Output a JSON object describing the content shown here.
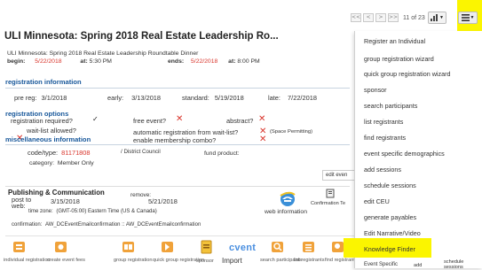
{
  "pager": {
    "first": "<<",
    "prev": "<",
    "next": ">",
    "last": ">>",
    "count": "11 of 23"
  },
  "event": {
    "title": "ULI Minnesota: Spring 2018 Real Estate Leadership Ro...",
    "subtitle": "ULI Minnesota: Spring 2018 Real Estate Leadership Roundtable Dinner",
    "begin_label": "begin:",
    "begin_date": "5/22/2018",
    "at_label": "at:",
    "begin_time": "5:30 PM",
    "ends_label": "ends:",
    "end_date": "5/22/2018",
    "end_at_label": "at:",
    "end_time": "8:00 PM"
  },
  "registration_info": {
    "heading": "registration information",
    "prereg_label": "pre reg:",
    "prereg_date": "3/1/2018",
    "early_label": "early:",
    "early_date": "3/13/2018",
    "standard_label": "standard:",
    "standard_date": "5/19/2018",
    "late_label": "late:",
    "late_date": "7/22/2018"
  },
  "registration_options": {
    "heading": "registration options",
    "required_label": "registration required?",
    "required_mark": "✓",
    "free_label": "free event?",
    "free_mark": "✕",
    "abstract_label": "abstract?",
    "abstract_mark": "✕",
    "waitlist_label": "wait-list allowed?",
    "waitlist_mark": "✕",
    "auto_label": "automatic registration from wait-list?",
    "auto_mark": "✕",
    "auto_note": "(Space Permitting)",
    "combo_label": "enable membership combo?"
  },
  "misc": {
    "heading": "miscellaneous information",
    "code_label": "code/type:",
    "code_value": "81171808",
    "code_type": "/ District Council",
    "fund_label": "fund product:",
    "category_label": "category:",
    "category_value": "Member Only",
    "edit_label": "edit even"
  },
  "publishing": {
    "heading": "Publishing & Communication",
    "post_label": "post to web:",
    "post_date": "3/15/2018",
    "remove_label": "remove:",
    "remove_date": "5/21/2018",
    "web_info": "web information",
    "confirmation_te": "Confirmation Te",
    "timezone_label": "time zone:",
    "timezone_value": "(GMT-05:00) Eastern Time (US & Canada)",
    "confirmation_label": "confirmation:",
    "confirmation_value": "AW_DCEventEmailconfirmation :: AW_DCEventEmailconfirmation"
  },
  "menu": {
    "items": [
      "Register an Individual",
      "group registration wizard",
      "quick group registration wizard",
      "sponsor",
      "search participants",
      "list registrants",
      "find registrants",
      "event specific demographics",
      "add sessions",
      "schedule sessions",
      "edit CEU",
      "generate payables",
      "Edit Narrative/Video",
      "Knowledge Finder",
      "Event Specific"
    ],
    "bottom_add": "add",
    "bottom_schedule": "schedule sessions"
  },
  "icon_bar": {
    "individual": "individual registration",
    "create": "create event fees",
    "group": "group registration",
    "quick": "quick group registration",
    "sponsor": "sponsor",
    "import": "Import",
    "cvent": "cvent",
    "search": "search participants",
    "list": "list registrants",
    "find": "find registrants"
  },
  "highlight_color": "#fbf500",
  "accent_blue": "#17579a",
  "date_red": "#d9342b"
}
